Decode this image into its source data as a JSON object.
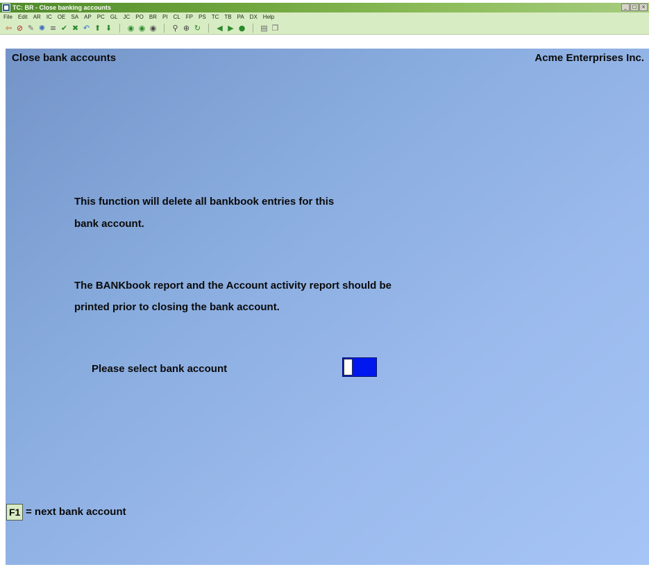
{
  "window": {
    "title": "TC: BR - Close banking accounts",
    "buttons": {
      "minimize": "_",
      "maximize": "□",
      "close": "×"
    }
  },
  "menu": [
    "File",
    "Edit",
    "AR",
    "IC",
    "OE",
    "SA",
    "AP",
    "PC",
    "GL",
    "JC",
    "PO",
    "BR",
    "PI",
    "CL",
    "FP",
    "PS",
    "TC",
    "TB",
    "PA",
    "DX",
    "Help"
  ],
  "toolbar": {
    "groups": [
      [
        {
          "name": "exit-icon",
          "glyph": "⇦",
          "color": "#c84a10"
        },
        {
          "name": "cancel-icon",
          "glyph": "⊘",
          "color": "#b02020"
        },
        {
          "name": "tools-icon",
          "glyph": "✎",
          "color": "#6a6a6a"
        },
        {
          "name": "settings-icon",
          "glyph": "✺",
          "color": "#3e6cc0"
        },
        {
          "name": "print-icon",
          "glyph": "≡",
          "color": "#555555"
        },
        {
          "name": "accept-icon",
          "glyph": "✔",
          "color": "#2b8a2b"
        },
        {
          "name": "delete-icon",
          "glyph": "✖",
          "color": "#2b8a2b"
        },
        {
          "name": "undo-icon",
          "glyph": "↶",
          "color": "#2b6bd0"
        },
        {
          "name": "arrow-up-icon",
          "glyph": "⬆",
          "color": "#2b8a2b"
        },
        {
          "name": "arrow-down-icon",
          "glyph": "⬇",
          "color": "#2b8a2b"
        }
      ],
      [
        {
          "name": "first-record-icon",
          "glyph": "◉",
          "color": "#2b8a2b"
        },
        {
          "name": "next-record-icon",
          "glyph": "◉",
          "color": "#2b8a2b"
        },
        {
          "name": "last-record-icon",
          "glyph": "◉",
          "color": "#4a4a4a"
        }
      ],
      [
        {
          "name": "find-icon",
          "glyph": "⚲",
          "color": "#444444"
        },
        {
          "name": "zoom-icon",
          "glyph": "⊕",
          "color": "#444444"
        },
        {
          "name": "refresh-icon",
          "glyph": "↻",
          "color": "#2b8a2b"
        }
      ],
      [
        {
          "name": "previous-icon",
          "glyph": "◀",
          "color": "#2b8a2b"
        },
        {
          "name": "next-icon",
          "glyph": "▶",
          "color": "#2b8a2b"
        },
        {
          "name": "help-icon",
          "glyph": "●",
          "color": "#2b8a2b"
        }
      ],
      [
        {
          "name": "save-icon",
          "glyph": "▤",
          "color": "#6a6a6a"
        },
        {
          "name": "copy-icon",
          "glyph": "❐",
          "color": "#6a6a6a"
        }
      ]
    ]
  },
  "screen": {
    "title": "Close bank accounts",
    "company": "Acme Enterprises Inc.",
    "message1": {
      "line1": "This function will delete all bankbook entries for this",
      "line2": "bank account."
    },
    "message2": {
      "line1": "The BANKbook report and the Account activity report should be",
      "line2": "printed prior to closing the bank account."
    },
    "prompt": "Please select bank account",
    "bank_account_value": "",
    "fkey": {
      "key": "F1",
      "description": "= next bank account"
    }
  },
  "colors": {
    "title_bar": "#6ea43c",
    "menu_bar": "#d8ecc4",
    "content_start": "#7494c8",
    "content_end": "#a6c5f6",
    "input_field": "#0018ee"
  }
}
